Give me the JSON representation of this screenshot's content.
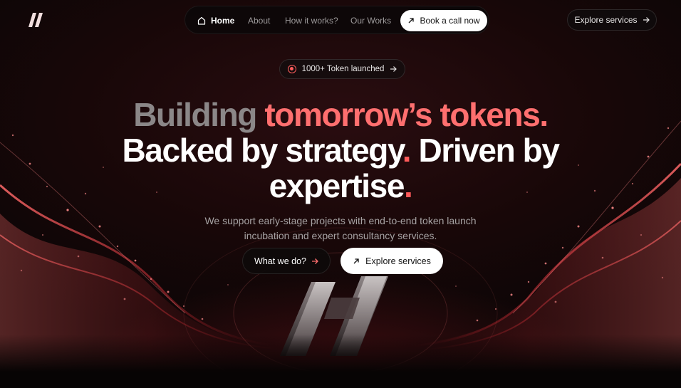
{
  "nav": {
    "items": [
      {
        "label": "Home",
        "icon": "home-icon",
        "active": true
      },
      {
        "label": "About"
      },
      {
        "label": "How it works?"
      },
      {
        "label": "Our Works"
      }
    ],
    "cta_label": "Book a call now",
    "cta_icon": "arrow-up-right-icon"
  },
  "header_cta": {
    "label": "Explore services",
    "icon": "arrow-right-icon"
  },
  "badge": {
    "label": "1000+ Token launched",
    "icon": "target-icon"
  },
  "hero": {
    "line1_muted": "Building",
    "line1_accent": "tomorrow’s tokens.",
    "line2": "Backed by strategy",
    "line2_dot": ".",
    "line2_rest": "Driven by",
    "line3": "expertise",
    "line3_dot": ".",
    "subtext": "We support early-stage projects with end-to-end token launch incubation and expert consultancy services.",
    "primary_button": {
      "label": "What we do?",
      "icon": "arrow-right-icon"
    },
    "secondary_button": {
      "label": "Explore services",
      "icon": "arrow-up-right-icon"
    }
  },
  "colors": {
    "accent": "#ff6f6f",
    "background": "#0a0707",
    "muted_text": "#8b8788"
  }
}
